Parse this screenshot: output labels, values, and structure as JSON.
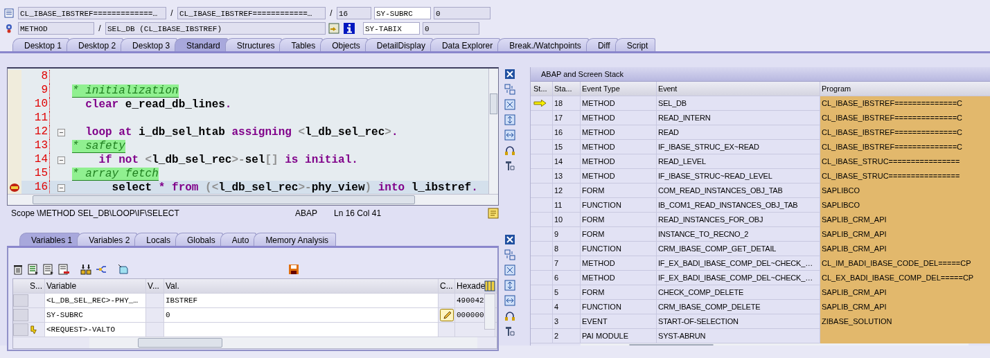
{
  "header": {
    "program_line": {
      "program": "CL_IBASE_IBSTREF=============…",
      "separator_1": "/",
      "include": "CL_IBASE_IBSTREF============…",
      "separator_2": "/",
      "line": "16",
      "system_field": "SY-SUBRC",
      "system_value": "0"
    },
    "event_line": {
      "event_type": "METHOD",
      "separator": "/",
      "event": "SEL_DB (CL_IBASE_IBSTREF)",
      "system_field": "SY-TABIX",
      "system_value": "0"
    }
  },
  "tabs": [
    {
      "label": "Desktop 1",
      "selected": false
    },
    {
      "label": "Desktop 2",
      "selected": false
    },
    {
      "label": "Desktop 3",
      "selected": false
    },
    {
      "label": "Standard",
      "selected": true
    },
    {
      "label": "Structures",
      "selected": false
    },
    {
      "label": "Tables",
      "selected": false
    },
    {
      "label": "Objects",
      "selected": false
    },
    {
      "label": "DetailDisplay",
      "selected": false
    },
    {
      "label": "Data Explorer",
      "selected": false
    },
    {
      "label": "Break./Watchpoints",
      "selected": false
    },
    {
      "label": "Diff",
      "selected": false
    },
    {
      "label": "Script",
      "selected": false
    }
  ],
  "editor": {
    "lines": [
      {
        "number": "8",
        "fold": false,
        "current": false
      },
      {
        "number": "9",
        "fold": false,
        "current": false,
        "segments": [
          {
            "kind": "comment",
            "text": "* initialization"
          }
        ]
      },
      {
        "number": "10",
        "fold": false,
        "current": false,
        "segments": [
          {
            "kind": "kw",
            "text": "  clear"
          },
          {
            "kind": "id",
            "text": " e_read_db_lines"
          },
          {
            "kind": "kw",
            "text": "."
          }
        ]
      },
      {
        "number": "11",
        "fold": false,
        "current": false
      },
      {
        "number": "12",
        "fold": true,
        "current": false,
        "segments": [
          {
            "kind": "kw",
            "text": "  loop at"
          },
          {
            "kind": "id",
            "text": " i_db_sel_htab "
          },
          {
            "kind": "kw",
            "text": "assigning"
          },
          {
            "kind": "op",
            "text": " <"
          },
          {
            "kind": "id",
            "text": "l_db_sel_rec"
          },
          {
            "kind": "op",
            "text": ">"
          },
          {
            "kind": "kw",
            "text": "."
          }
        ]
      },
      {
        "number": "13",
        "fold": false,
        "current": false,
        "segments": [
          {
            "kind": "comment",
            "text": "* safety"
          }
        ]
      },
      {
        "number": "14",
        "fold": true,
        "current": false,
        "segments": [
          {
            "kind": "kw",
            "text": "    if not"
          },
          {
            "kind": "op",
            "text": " <"
          },
          {
            "kind": "id",
            "text": "l_db_sel_rec"
          },
          {
            "kind": "op",
            "text": ">-"
          },
          {
            "kind": "id",
            "text": "sel"
          },
          {
            "kind": "op",
            "text": "[]"
          },
          {
            "kind": "kw",
            "text": " is initial."
          }
        ]
      },
      {
        "number": "15",
        "fold": false,
        "current": false,
        "segments": [
          {
            "kind": "comment",
            "text": "* array fetch"
          }
        ]
      },
      {
        "number": "16",
        "fold": true,
        "current": true,
        "segments": [
          {
            "kind": "id",
            "text": "      select"
          },
          {
            "kind": "kw",
            "text": " * from"
          },
          {
            "kind": "op",
            "text": " (<"
          },
          {
            "kind": "id",
            "text": "l_db_sel_rec"
          },
          {
            "kind": "op",
            "text": ">-"
          },
          {
            "kind": "id",
            "text": "phy_view"
          },
          {
            "kind": "op",
            "text": ")"
          },
          {
            "kind": "kw",
            "text": " into"
          },
          {
            "kind": "id",
            "text": " l_ibstref"
          },
          {
            "kind": "kw",
            "text": "."
          }
        ]
      }
    ],
    "status": {
      "scope": "Scope \\METHOD SEL_DB\\LOOP\\IF\\SELECT",
      "language": "ABAP",
      "position": "Ln  16 Col  41"
    }
  },
  "variables": {
    "tabs": [
      {
        "label": "Variables 1",
        "selected": true
      },
      {
        "label": "Variables 2",
        "selected": false
      },
      {
        "label": "Locals",
        "selected": false
      },
      {
        "label": "Globals",
        "selected": false
      },
      {
        "label": "Auto",
        "selected": false
      },
      {
        "label": "Memory Analysis",
        "selected": false
      }
    ],
    "columns": [
      "S...",
      "Variable",
      "V...",
      "Val.",
      "C...",
      "Hexade"
    ],
    "rows": [
      {
        "changed": false,
        "variable": "<L_DB_SEL_REC>-PHY_…",
        "value": "IBSTREF",
        "editable": false,
        "hex": "490042"
      },
      {
        "changed": false,
        "variable": "SY-SUBRC",
        "value": "0",
        "editable": true,
        "hex": "000000"
      },
      {
        "changed": true,
        "variable": "<REQUEST>-VALTO",
        "editable": false
      }
    ]
  },
  "stack": {
    "title": "ABAP and Screen Stack",
    "columns": [
      "St...",
      "Sta...",
      "Event Type",
      "Event",
      "Program"
    ],
    "rows": [
      {
        "current": true,
        "level": "18",
        "event_type": "METHOD",
        "event": "SEL_DB",
        "program": "CL_IBASE_IBSTREF==============C"
      },
      {
        "current": false,
        "level": "17",
        "event_type": "METHOD",
        "event": "READ_INTERN",
        "program": "CL_IBASE_IBSTREF==============C"
      },
      {
        "current": false,
        "level": "16",
        "event_type": "METHOD",
        "event": "READ",
        "program": "CL_IBASE_IBSTREF==============C"
      },
      {
        "current": false,
        "level": "15",
        "event_type": "METHOD",
        "event": "IF_IBASE_STRUC_EX~READ",
        "program": "CL_IBASE_IBSTREF==============C"
      },
      {
        "current": false,
        "level": "14",
        "event_type": "METHOD",
        "event": "READ_LEVEL",
        "program": "CL_IBASE_STRUC================"
      },
      {
        "current": false,
        "level": "13",
        "event_type": "METHOD",
        "event": "IF_IBASE_STRUC~READ_LEVEL",
        "program": "CL_IBASE_STRUC================"
      },
      {
        "current": false,
        "level": "12",
        "event_type": "FORM",
        "event": "COM_READ_INSTANCES_OBJ_TAB",
        "program": "SAPLIBCO"
      },
      {
        "current": false,
        "level": "11",
        "event_type": "FUNCTION",
        "event": "IB_COM1_READ_INSTANCES_OBJ_TAB",
        "program": "SAPLIBCO"
      },
      {
        "current": false,
        "level": "10",
        "event_type": "FORM",
        "event": "READ_INSTANCES_FOR_OBJ",
        "program": "SAPLIB_CRM_API"
      },
      {
        "current": false,
        "level": "9",
        "event_type": "FORM",
        "event": "INSTANCE_TO_RECNO_2",
        "program": "SAPLIB_CRM_API"
      },
      {
        "current": false,
        "level": "8",
        "event_type": "FUNCTION",
        "event": "CRM_IBASE_COMP_GET_DETAIL",
        "program": "SAPLIB_CRM_API"
      },
      {
        "current": false,
        "level": "7",
        "event_type": "METHOD",
        "event": "IF_EX_BADI_IBASE_COMP_DEL~CHECK_…",
        "program": "CL_IM_BADI_IBASE_CODE_DEL=====CP"
      },
      {
        "current": false,
        "level": "6",
        "event_type": "METHOD",
        "event": "IF_EX_BADI_IBASE_COMP_DEL~CHECK_…",
        "program": "CL_EX_BADI_IBASE_COMP_DEL=====CP"
      },
      {
        "current": false,
        "level": "5",
        "event_type": "FORM",
        "event": "CHECK_COMP_DELETE",
        "program": "SAPLIB_CRM_API"
      },
      {
        "current": false,
        "level": "4",
        "event_type": "FUNCTION",
        "event": "CRM_IBASE_COMP_DELETE",
        "program": "SAPLIB_CRM_API"
      },
      {
        "current": false,
        "level": "3",
        "event_type": "EVENT",
        "event": "START-OF-SELECTION",
        "program": "ZIBASE_SOLUTION"
      },
      {
        "current": false,
        "level": "2",
        "event_type": "PAI MODULE",
        "event": "SYST-ABRUN"
      }
    ]
  }
}
